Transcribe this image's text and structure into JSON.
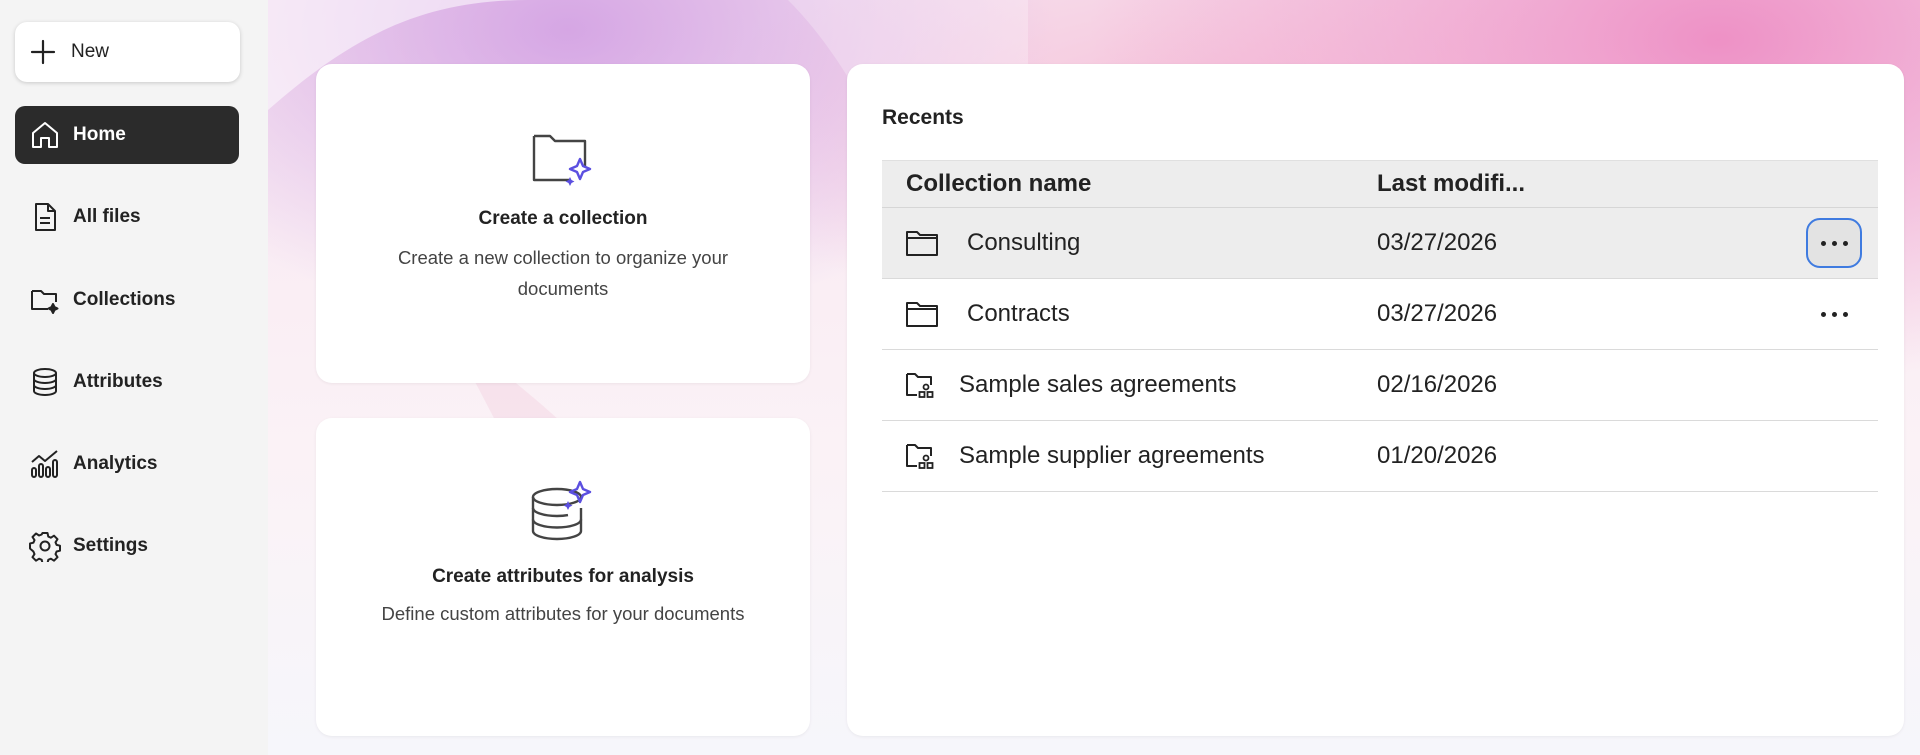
{
  "sidebar": {
    "new_label": "New",
    "items": [
      {
        "label": "Home",
        "icon": "home-icon",
        "active": true
      },
      {
        "label": "All files",
        "icon": "file-icon",
        "active": false
      },
      {
        "label": "Collections",
        "icon": "collections-icon",
        "active": false
      },
      {
        "label": "Attributes",
        "icon": "database-icon",
        "active": false
      },
      {
        "label": "Analytics",
        "icon": "analytics-icon",
        "active": false
      },
      {
        "label": "Settings",
        "icon": "gear-icon",
        "active": false
      }
    ]
  },
  "cards": {
    "collection": {
      "title": "Create a collection",
      "description": "Create a new collection to organize your documents",
      "icon": "folder-sparkle-icon"
    },
    "attributes": {
      "title": "Create attributes for analysis",
      "description": "Define custom attributes for your documents",
      "icon": "database-sparkle-icon"
    }
  },
  "recents": {
    "title": "Recents",
    "columns": [
      "Collection name",
      "Last modifi..."
    ],
    "rows": [
      {
        "name": "Consulting",
        "date": "03/27/2026",
        "icon": "folder-icon",
        "has_menu": true,
        "hover": true
      },
      {
        "name": "Contracts",
        "date": "03/27/2026",
        "icon": "folder-icon",
        "has_menu": true,
        "hover": false
      },
      {
        "name": "Sample sales agreements",
        "date": "02/16/2026",
        "icon": "shared-folder-icon",
        "has_menu": false,
        "hover": false
      },
      {
        "name": "Sample supplier agreements",
        "date": "01/20/2026",
        "icon": "shared-folder-icon",
        "has_menu": false,
        "hover": false
      }
    ]
  },
  "colors": {
    "active_nav": "#2b2b2b",
    "sparkle": "#5b4fe0",
    "focus_ring": "#3f7be0"
  }
}
